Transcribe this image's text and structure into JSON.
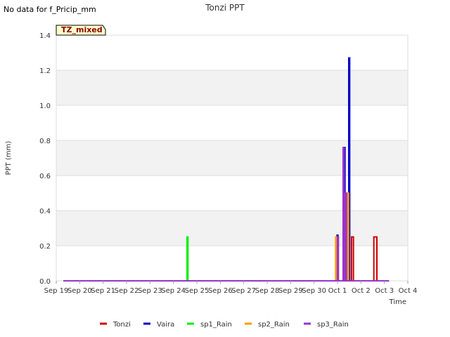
{
  "no_data_message": "No data for f_Pricip_mm",
  "tz_label": "TZ_mixed",
  "chart_data": {
    "type": "line",
    "title": "Tonzi PPT",
    "xlabel": "Time",
    "ylabel": "PPT (mm)",
    "xlim": [
      0,
      15
    ],
    "ylim": [
      0,
      1.4
    ],
    "x_tick_labels": [
      "Sep 19",
      "Sep 20",
      "Sep 21",
      "Sep 22",
      "Sep 23",
      "Sep 24",
      "Sep 25",
      "Sep 26",
      "Sep 27",
      "Sep 28",
      "Sep 29",
      "Sep 30",
      "Oct 1",
      "Oct 2",
      "Oct 3",
      "Oct 4"
    ],
    "y_ticks": [
      0.0,
      0.2,
      0.4,
      0.6,
      0.8,
      1.0,
      1.2,
      1.4
    ],
    "y_tick_labels": [
      "0.0",
      "0.2",
      "0.4",
      "0.6",
      "0.8",
      "1.0",
      "1.2",
      "1.4"
    ],
    "grid": true,
    "legend_position": "bottom",
    "series": [
      {
        "name": "Tonzi",
        "color": "#cc0000",
        "points": [
          [
            0.3,
            0
          ],
          [
            12.6,
            0
          ],
          [
            12.6,
            0.25
          ],
          [
            12.68,
            0.25
          ],
          [
            12.68,
            0
          ],
          [
            13.55,
            0
          ],
          [
            13.55,
            0.25
          ],
          [
            13.68,
            0.25
          ],
          [
            13.68,
            0
          ],
          [
            14.2,
            0
          ]
        ]
      },
      {
        "name": "Vaira",
        "color": "#0000cc",
        "points": [
          [
            0.3,
            0
          ],
          [
            11.98,
            0
          ],
          [
            11.98,
            0.26
          ],
          [
            12.02,
            0.26
          ],
          [
            12.02,
            0
          ],
          [
            12.28,
            0
          ],
          [
            12.28,
            0.76
          ],
          [
            12.32,
            0.76
          ],
          [
            12.32,
            0
          ],
          [
            12.48,
            0
          ],
          [
            12.48,
            1.27
          ],
          [
            12.52,
            1.27
          ],
          [
            12.52,
            0
          ],
          [
            14.2,
            0
          ]
        ]
      },
      {
        "name": "sp1_Rain",
        "color": "#00ee00",
        "points": [
          [
            0.3,
            0
          ],
          [
            5.58,
            0
          ],
          [
            5.58,
            0.25
          ],
          [
            5.62,
            0.25
          ],
          [
            5.62,
            0
          ],
          [
            14.2,
            0
          ]
        ]
      },
      {
        "name": "sp2_Rain",
        "color": "#ff9900",
        "points": [
          [
            0.3,
            0
          ],
          [
            11.92,
            0
          ],
          [
            11.92,
            0.25
          ],
          [
            11.97,
            0.25
          ],
          [
            11.97,
            0
          ],
          [
            12.32,
            0
          ],
          [
            12.32,
            0.5
          ],
          [
            12.37,
            0.5
          ],
          [
            12.37,
            0
          ],
          [
            12.42,
            0
          ],
          [
            12.42,
            0.5
          ],
          [
            12.47,
            0.5
          ],
          [
            12.47,
            0
          ],
          [
            14.2,
            0
          ]
        ]
      },
      {
        "name": "sp3_Rain",
        "color": "#9933cc",
        "points": [
          [
            0.3,
            0
          ],
          [
            12.0,
            0
          ],
          [
            12.0,
            0.25
          ],
          [
            12.04,
            0.25
          ],
          [
            12.04,
            0
          ],
          [
            12.24,
            0
          ],
          [
            12.24,
            0.76
          ],
          [
            12.28,
            0.76
          ],
          [
            12.28,
            0
          ],
          [
            12.34,
            0
          ],
          [
            12.34,
            0.5
          ],
          [
            12.38,
            0.5
          ],
          [
            12.38,
            0
          ],
          [
            14.2,
            0
          ]
        ]
      }
    ]
  }
}
